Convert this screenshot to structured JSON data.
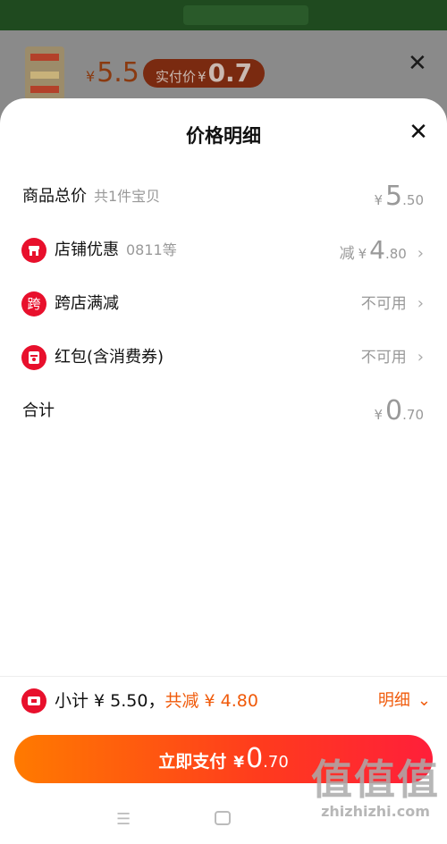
{
  "background": {
    "price_currency": "¥",
    "price_value": "5.5",
    "pill_label": "实付价",
    "pill_currency": "¥",
    "pill_value": "0.7",
    "close_icon": "close-icon"
  },
  "sheet": {
    "title": "价格明细",
    "close_icon": "close-icon"
  },
  "rows": [
    {
      "label": "商品总价",
      "sub": "共1件宝贝",
      "currency": "¥",
      "int": "5",
      "dec": ".50"
    },
    {
      "icon": "shop-icon",
      "label": "店铺优惠",
      "sub": "0811等",
      "prefix": "减",
      "currency": "¥",
      "int": "4",
      "dec": ".80"
    },
    {
      "icon_text": "跨",
      "label": "跨店满减",
      "right": "不可用"
    },
    {
      "icon": "red-packet-icon",
      "label": "红包(含消费券)",
      "right": "不可用"
    },
    {
      "label": "合计",
      "currency": "¥",
      "int": "0",
      "dec": ".70"
    }
  ],
  "summary": {
    "icon": "coupon-ticket-icon",
    "subtotal_text": "小计 ¥ 5.50，",
    "discount_text": "共减 ¥ 4.80",
    "detail_label": "明细",
    "detail_icon": "chevron-down-icon"
  },
  "pay_button": {
    "label": "立即支付",
    "currency": "¥",
    "int": "0",
    "dec": ".70"
  },
  "watermark": {
    "big": "值值值",
    "small": "zhizhizhi.com"
  },
  "colors": {
    "accent_orange": "#f05a0a",
    "icon_red": "#e8102c",
    "pay_gradient_start": "#ff7a00",
    "pay_gradient_end": "#ff1f3a"
  }
}
